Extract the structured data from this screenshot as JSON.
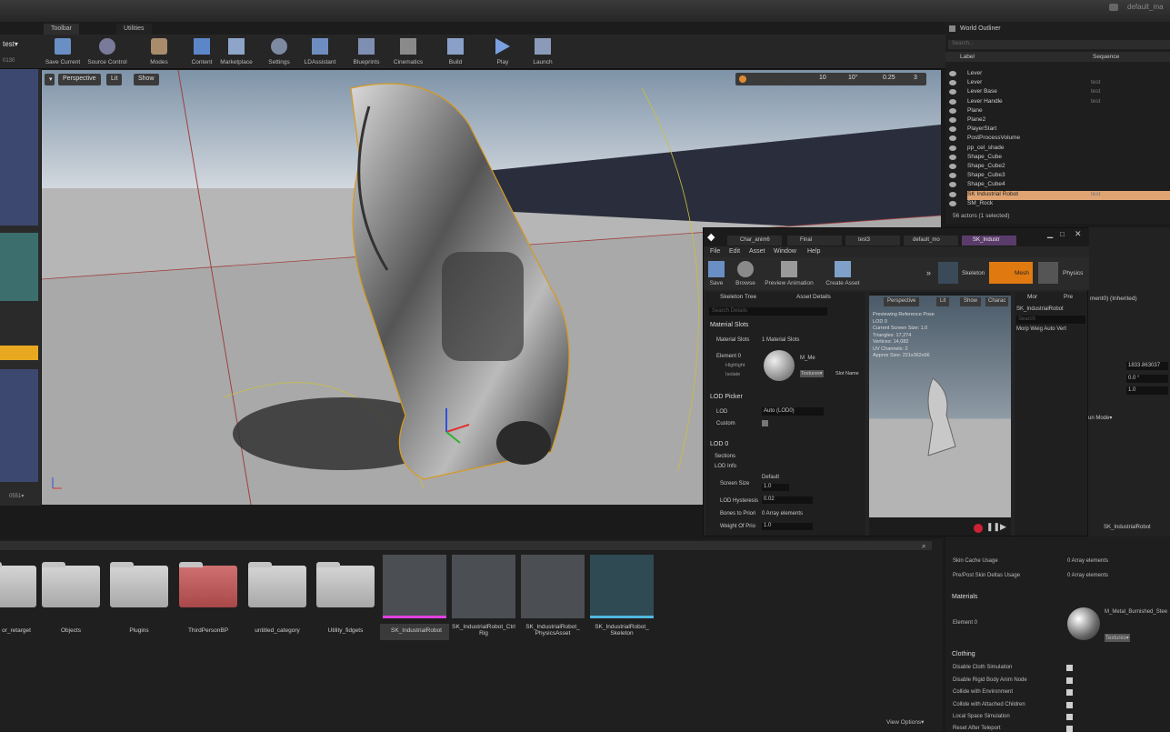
{
  "title_bar": {
    "text": "default_ma"
  },
  "tabs": [
    "Toolbar",
    "Utilities"
  ],
  "left": {
    "level_label": "test▾",
    "bottom_readout": "0551▾",
    "small_text": "0130"
  },
  "toolbar": [
    {
      "label": "Save Current"
    },
    {
      "label": "Source Control"
    },
    {
      "label": "Modes"
    },
    {
      "label": "Content"
    },
    {
      "label": "Marketplace"
    },
    {
      "label": "Settings"
    },
    {
      "label": "LDAssistant"
    },
    {
      "label": "Blueprints"
    },
    {
      "label": "Cinematics"
    },
    {
      "label": "Build"
    },
    {
      "label": "Play"
    },
    {
      "label": "Launch"
    }
  ],
  "viewport": {
    "perspective": "Perspective",
    "lit": "Lit",
    "show": "Show",
    "snap_angle": "10°",
    "grid": "10",
    "scale": "0.25",
    "cam_speed": "3"
  },
  "outliner": {
    "title": "World Outliner",
    "search_placeholder": "Search...",
    "col_label": "Label",
    "col_sequence": "Sequence",
    "rows": [
      {
        "label": "Lever",
        "seq": ""
      },
      {
        "label": "Lever",
        "seq": "test"
      },
      {
        "label": "Lever Base",
        "seq": "test"
      },
      {
        "label": "Lever Handle",
        "seq": "test"
      },
      {
        "label": "Plane",
        "seq": ""
      },
      {
        "label": "Plane2",
        "seq": ""
      },
      {
        "label": "PlayerStart",
        "seq": ""
      },
      {
        "label": "PostProcessVolume",
        "seq": ""
      },
      {
        "label": "pp_cel_shade",
        "seq": ""
      },
      {
        "label": "Shape_Cube",
        "seq": ""
      },
      {
        "label": "Shape_Cube2",
        "seq": ""
      },
      {
        "label": "Shape_Cube3",
        "seq": ""
      },
      {
        "label": "Shape_Cube4",
        "seq": ""
      },
      {
        "label": "SK Industrial Robot",
        "seq": "test"
      },
      {
        "label": "SM_Rock",
        "seq": ""
      }
    ],
    "status": "56 actors (1 selected)"
  },
  "persona": {
    "tabs": [
      "Char_anim6",
      "Final",
      "test3",
      "default_mo",
      "SK_Industr"
    ],
    "menu": [
      "File",
      "Edit",
      "Asset",
      "Window",
      "Help"
    ],
    "tools": [
      "Save",
      "Browse",
      "Preview Animation",
      "Create Asset"
    ],
    "modes": [
      "Skeleton",
      "Mesh",
      "Physics"
    ],
    "skeleton_tree": "Skeleton Tree",
    "asset_details": "Asset Details",
    "search_details": "Search Details",
    "material_slots_header": "Material Slots",
    "material_slots_label": "Material Slots",
    "material_slots_value": "1 Material Slots",
    "element0": "Element 0",
    "highlight": "Highlight",
    "isolate": "Isolate",
    "mat_name": "M_Me",
    "textures": "Textures▾",
    "slot_name": "Slot Name",
    "lod_picker": "LOD Picker",
    "lod_label": "LOD",
    "lod_value": "Auto (LOD0)",
    "custom": "Custom",
    "lod0": "LOD 0",
    "sections": "Sections",
    "lod_info": "LOD Info",
    "screen_size": "Screen Size",
    "screen_default": "Default",
    "screen_val": "1.0",
    "lod_hysteresis": "LOD Hysteresis",
    "hyst_val": "0.02",
    "bones_prioritize": "Bones to Priori",
    "bones_val": "0 Array elements",
    "weight_prio": "Weight Of Prio",
    "weight_val": "1.0",
    "vp_perspective": "Perspective",
    "vp_lit": "Lit",
    "vp_show": "Show",
    "vp_char": "Charac",
    "overlay": [
      "Previewing Reference Pose",
      "LOD 0",
      "Current Screen Size: 1.0",
      "Triangles: 17,274",
      "Vertices: 14,082",
      "UV Channels: 2",
      "Approx Size: 221x362x66"
    ],
    "morph_tab": "Mor",
    "pre_tab": "Pre",
    "morph_asset": "SK_IndustrialRobot",
    "morph_search": "Search",
    "morph_cols": [
      "Morp",
      "Weig",
      "Auto",
      "Vert"
    ]
  },
  "right_mid": {
    "inherited": "ment0) (Inherited)",
    "v1": "1833.863037",
    "v2": "0.0 °",
    "v3": "1.0",
    "mode": "un Mode▾"
  },
  "content": {
    "folders": [
      "or_retarget",
      "Objects",
      "Plugins",
      "ThirdPersonBP",
      "untitled_category",
      "Utility_fidgets"
    ],
    "assets": [
      {
        "label": "SK_IndustrialRobot"
      },
      {
        "label": "SK_IndustrialRobot_Ctrl Rig"
      },
      {
        "label": "SK_IndustrialRobot_ PhysicsAsset"
      },
      {
        "label": "SK_IndustrialRobot_ Skeleton"
      }
    ],
    "view_options": "View Options▾"
  },
  "details": {
    "asset": "SK_IndustrialRobot",
    "skin_cache": "Skin Cache Usage",
    "skin_cache_val": "0 Array elements",
    "prepost": "Pre/Post Skin Deltas Usage",
    "prepost_val": "0 Array elements",
    "materials_header": "Materials",
    "element0": "Element 0",
    "material_name": "M_Metal_Burnished_Stee",
    "textures": "Textures▾",
    "clothing_header": "Clothing",
    "clothing": [
      "Disable Cloth Simulation",
      "Disable Rigid Body Anim Node",
      "Collide with Environment",
      "Collide with Attached Children",
      "Local Space Simulation",
      "Reset After Teleport"
    ]
  }
}
